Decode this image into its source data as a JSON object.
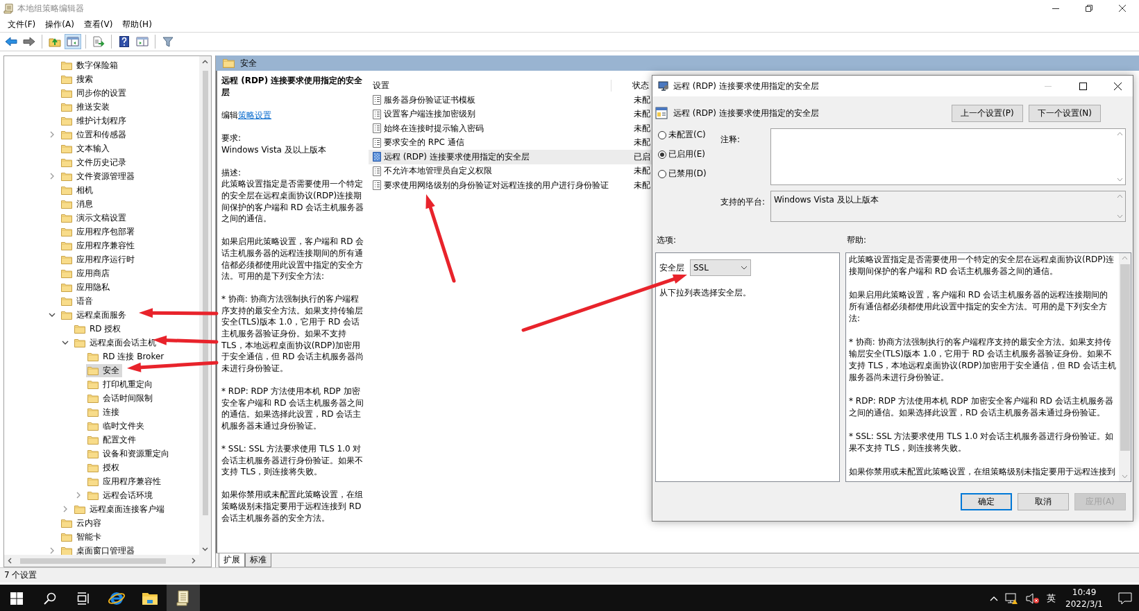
{
  "window": {
    "title": "本地组策略编辑器"
  },
  "menu": [
    "文件(F)",
    "操作(A)",
    "查看(V)",
    "帮助(H)"
  ],
  "toolbar": [
    {
      "kind": "back",
      "pressed": false
    },
    {
      "kind": "forward",
      "pressed": false
    },
    {
      "kind": "separator"
    },
    {
      "kind": "up",
      "pressed": false
    },
    {
      "kind": "tree_toggle",
      "pressed": true
    },
    {
      "kind": "separator"
    },
    {
      "kind": "export",
      "pressed": false
    },
    {
      "kind": "separator"
    },
    {
      "kind": "help",
      "pressed": false
    },
    {
      "kind": "view",
      "pressed": false
    },
    {
      "kind": "separator"
    },
    {
      "kind": "filter",
      "pressed": false
    }
  ],
  "tree": {
    "items": [
      {
        "label": "数字保险箱",
        "selected": false
      },
      {
        "label": "搜索",
        "selected": false
      },
      {
        "label": "同步你的设置",
        "selected": false
      },
      {
        "label": "推送安装",
        "selected": false
      },
      {
        "label": "维护计划程序",
        "selected": false
      },
      {
        "label": "位置和传感器",
        "selected": false,
        "expanded": false
      },
      {
        "label": "文本输入",
        "selected": false
      },
      {
        "label": "文件历史记录",
        "selected": false
      },
      {
        "label": "文件资源管理器",
        "selected": false,
        "expanded": false
      },
      {
        "label": "相机",
        "selected": false
      },
      {
        "label": "消息",
        "selected": false
      },
      {
        "label": "演示文稿设置",
        "selected": false
      },
      {
        "label": "应用程序包部署",
        "selected": false
      },
      {
        "label": "应用程序兼容性",
        "selected": false
      },
      {
        "label": "应用程序运行时",
        "selected": false
      },
      {
        "label": "应用商店",
        "selected": false
      },
      {
        "label": "应用隐私",
        "selected": false
      },
      {
        "label": "语音",
        "selected": false
      },
      {
        "label": "远程桌面服务",
        "selected": false,
        "expanded": true,
        "children": [
          {
            "label": "RD 授权",
            "selected": false
          },
          {
            "label": "远程桌面会话主机",
            "selected": false,
            "expanded": true,
            "children": [
              {
                "label": "RD 连接 Broker",
                "selected": false
              },
              {
                "label": "安全",
                "selected": true
              },
              {
                "label": "打印机重定向",
                "selected": false
              },
              {
                "label": "会话时间限制",
                "selected": false
              },
              {
                "label": "连接",
                "selected": false
              },
              {
                "label": "临时文件夹",
                "selected": false
              },
              {
                "label": "配置文件",
                "selected": false
              },
              {
                "label": "设备和资源重定向",
                "selected": false
              },
              {
                "label": "授权",
                "selected": false
              },
              {
                "label": "应用程序兼容性",
                "selected": false
              },
              {
                "label": "远程会话环境",
                "selected": false,
                "expanded": false
              }
            ]
          },
          {
            "label": "远程桌面连接客户端",
            "selected": false,
            "expanded": false
          }
        ]
      },
      {
        "label": "云内容",
        "selected": false
      },
      {
        "label": "智能卡",
        "selected": false
      },
      {
        "label": "桌面窗口管理器",
        "selected": false,
        "expanded": false
      }
    ]
  },
  "pane": {
    "header": "安全",
    "description": {
      "title": "远程 (RDP) 连接要求使用指定的安全层",
      "edit_prefix": "编辑",
      "edit_link": "策略设置",
      "requirement_label": "要求:",
      "requirement": "Windows Vista 及以上版本",
      "description_label": "描述:",
      "paragraphs": [
        "此策略设置指定是否需要使用一个特定的安全层在远程桌面协议(RDP)连接期间保护的客户端和 RD 会话主机服务器之间的通信。",
        "如果启用此策略设置，客户端和 RD 会话主机服务器的远程连接期间的所有通信都必须都使用此设置中指定的安全方法。可用的是下列安全方法:",
        "* 协商: 协商方法强制执行的客户端程序支持的最安全方法。如果支持传输层安全(TLS)版本 1.0，它用于 RD 会话主机服务器验证身份。如果不支持 TLS，本地远程桌面协议(RDP)加密用于安全通信，但 RD 会话主机服务器尚未进行身份验证。",
        "* RDP: RDP 方法使用本机 RDP 加密安全客户端和 RD 会话主机服务器之间的通信。如果选择此设置，RD 会话主机服务器未通过身份验证。",
        "* SSL: SSL 方法要求使用 TLS 1.0 对会话主机服务器进行身份验证。如果不支持 TLS，则连接将失败。",
        "如果你禁用或未配置此策略设置，在组策略级别未指定要用于远程连接到 RD 会话主机服务器的安全方法。"
      ]
    },
    "settings": {
      "columns": [
        "设置",
        "状态"
      ],
      "rows": [
        {
          "name": "服务器身份验证证书模板",
          "status": "未配",
          "kind": "policy",
          "selected": false
        },
        {
          "name": "设置客户端连接加密级别",
          "status": "未配",
          "kind": "policy",
          "selected": false
        },
        {
          "name": "始终在连接时提示输入密码",
          "status": "未配",
          "kind": "policy",
          "selected": false
        },
        {
          "name": "要求安全的 RPC 通信",
          "status": "未配",
          "kind": "policy",
          "selected": false
        },
        {
          "name": "远程 (RDP) 连接要求使用指定的安全层",
          "status": "已启",
          "kind": "policy_enabled",
          "selected": true
        },
        {
          "name": "不允许本地管理员自定义权限",
          "status": "未配",
          "kind": "policy",
          "selected": false
        },
        {
          "name": "要求使用网络级别的身份验证对远程连接的用户进行身份验证",
          "status": "未配",
          "kind": "policy",
          "selected": false
        }
      ]
    },
    "tabs": [
      {
        "label": "扩展",
        "selected": true
      },
      {
        "label": "标准",
        "selected": false
      }
    ]
  },
  "status_bar": {
    "text": "7 个设置"
  },
  "dialog": {
    "title": "远程 (RDP) 连接要求使用指定的安全层",
    "heading": "远程 (RDP) 连接要求使用指定的安全层",
    "nav_buttons": [
      "上一个设置(P)",
      "下一个设置(N)"
    ],
    "options": [
      {
        "label": "未配置(C)",
        "selected": false
      },
      {
        "label": "已启用(E)",
        "selected": true
      },
      {
        "label": "已禁用(D)",
        "selected": false
      }
    ],
    "comment_label": "注释:",
    "platform_label": "支持的平台:",
    "platform": "Windows Vista 及以上版本",
    "options_label": "选项:",
    "help_label": "帮助:",
    "security_layer": {
      "label": "安全层",
      "value": "SSL",
      "hint": "从下拉列表选择安全层。"
    },
    "help": [
      "此策略设置指定是否需要使用一个特定的安全层在远程桌面协议(RDP)连接期间保护的客户端和 RD 会话主机服务器之间的通信。",
      "如果启用此策略设置，客户端和 RD 会话主机服务器的远程连接期间的所有通信都必须都使用此设置中指定的安全方法。可用的是下列安全方法:",
      "* 协商: 协商方法强制执行的客户端程序支持的最安全方法。如果支持传输层安全(TLS)版本 1.0，它用于 RD 会话主机服务器验证身份。如果不支持 TLS，本地远程桌面协议(RDP)加密用于安全通信，但 RD 会话主机服务器尚未进行身份验证。",
      "* RDP: RDP 方法使用本机 RDP 加密安全客户端和 RD 会话主机服务器之间的通信。如果选择此设置，RD 会话主机服务器未通过身份验证。",
      "* SSL: SSL 方法要求使用 TLS 1.0 对会话主机服务器进行身份验证。如果不支持 TLS，则连接将失败。",
      "如果你禁用或未配置此策略设置，在组策略级别未指定要用于远程连接到"
    ],
    "buttons": [
      {
        "label": "确定",
        "default": true,
        "disabled": false
      },
      {
        "label": "取消",
        "default": false,
        "disabled": false
      },
      {
        "label": "应用(A)",
        "default": false,
        "disabled": true
      }
    ]
  },
  "taskbar": {
    "apps": [
      {
        "kind": "start",
        "active": false
      },
      {
        "kind": "search",
        "active": false
      },
      {
        "kind": "task_view",
        "active": false
      },
      {
        "kind": "browser",
        "active": false
      },
      {
        "kind": "explorer",
        "active": false
      },
      {
        "kind": "gpedit",
        "active": true
      }
    ],
    "ime": "英",
    "time": "10:49",
    "date": "2022/3/1"
  }
}
